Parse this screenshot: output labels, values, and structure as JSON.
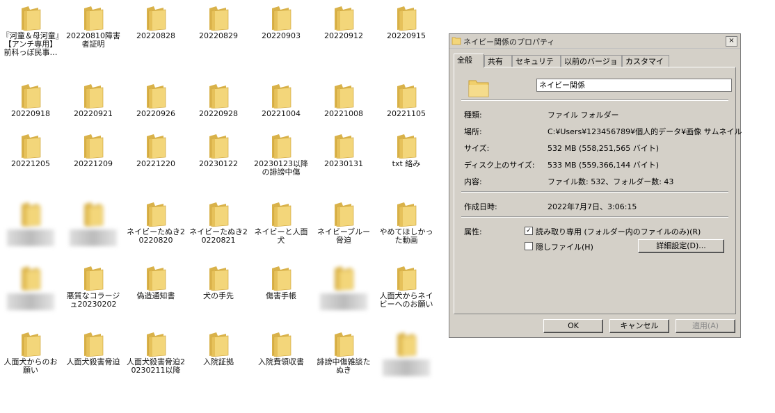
{
  "folders": [
    {
      "label": "『河童＆母河童』【アンチ専用】前科っぽ民事…",
      "blur": false
    },
    {
      "label": "20220810障害者証明",
      "blur": false
    },
    {
      "label": "20220828",
      "blur": false
    },
    {
      "label": "20220829",
      "blur": false
    },
    {
      "label": "20220903",
      "blur": false
    },
    {
      "label": "20220912",
      "blur": false
    },
    {
      "label": "20220915",
      "blur": false
    },
    {
      "label": "20220918",
      "blur": false
    },
    {
      "label": "20220921",
      "blur": false
    },
    {
      "label": "20220926",
      "blur": false
    },
    {
      "label": "20220928",
      "blur": false
    },
    {
      "label": "20221004",
      "blur": false
    },
    {
      "label": "20221008",
      "blur": false
    },
    {
      "label": "20221105",
      "blur": false
    },
    {
      "label": "20221205",
      "blur": false
    },
    {
      "label": "20221209",
      "blur": false
    },
    {
      "label": "20221220",
      "blur": false
    },
    {
      "label": "20230122",
      "blur": false
    },
    {
      "label": "20230123以降の誹謗中傷",
      "blur": false
    },
    {
      "label": "20230131",
      "blur": false
    },
    {
      "label": "txt 絡み",
      "blur": false
    },
    {
      "label": "",
      "blur": true
    },
    {
      "label": "",
      "blur": true
    },
    {
      "label": "ネイビーたぬき20220820",
      "blur": false
    },
    {
      "label": "ネイビーたぬき20220821",
      "blur": false
    },
    {
      "label": "ネイビーと人面犬",
      "blur": false
    },
    {
      "label": "ネイビーブルー脅迫",
      "blur": false
    },
    {
      "label": "やめてほしかった動画",
      "blur": false
    },
    {
      "label": "",
      "blur": true
    },
    {
      "label": "悪質なコラージュ20230202",
      "blur": false
    },
    {
      "label": "偽造通知書",
      "blur": false
    },
    {
      "label": "犬の手先",
      "blur": false
    },
    {
      "label": "傷害手帳",
      "blur": false
    },
    {
      "label": "",
      "blur": true
    },
    {
      "label": "人面犬からネイビーへのお願い",
      "blur": false
    },
    {
      "label": "人面犬からのお願い",
      "blur": false
    },
    {
      "label": "人面犬殺害脅迫",
      "blur": false
    },
    {
      "label": "人面犬殺害脅迫20230211以降",
      "blur": false
    },
    {
      "label": "入院証拠",
      "blur": false
    },
    {
      "label": "入院費領収書",
      "blur": false
    },
    {
      "label": "誹謗中傷雑談たぬき",
      "blur": false
    },
    {
      "label": "",
      "blur": true
    }
  ],
  "dialog": {
    "title": "ネイビー関係のプロパティ",
    "close": "×",
    "tabs": [
      "全般",
      "共有",
      "セキュリティ",
      "以前のバージョン",
      "カスタマイズ"
    ],
    "folder_name": "ネイビー関係",
    "rows": [
      {
        "key": "種類:",
        "value": "ファイル フォルダー"
      },
      {
        "key": "場所:",
        "value": "C:¥Users¥123456789¥個人的データ¥画像 サムネイル"
      },
      {
        "key": "サイズ:",
        "value": "532 MB (558,251,565 バイト)"
      },
      {
        "key": "ディスク上のサイズ:",
        "value": "533 MB (559,366,144 バイト)"
      },
      {
        "key": "内容:",
        "value": "ファイル数: 532、フォルダー数: 43"
      }
    ],
    "created_key": "作成日時:",
    "created_value": "2022年7月7日、3:06:15",
    "attr_key": "属性:",
    "readonly_label": "読み取り専用 (フォルダー内のファイルのみ)(R)",
    "readonly_check": "✓",
    "hidden_label": "隠しファイル(H)",
    "advanced_button": "詳細設定(D)...",
    "ok": "OK",
    "cancel": "キャンセル",
    "apply": "適用(A)"
  },
  "colors": {
    "folder": "#f3d67a",
    "folder_dark": "#d9b24a",
    "dialog_bg": "#d4d0c8"
  }
}
